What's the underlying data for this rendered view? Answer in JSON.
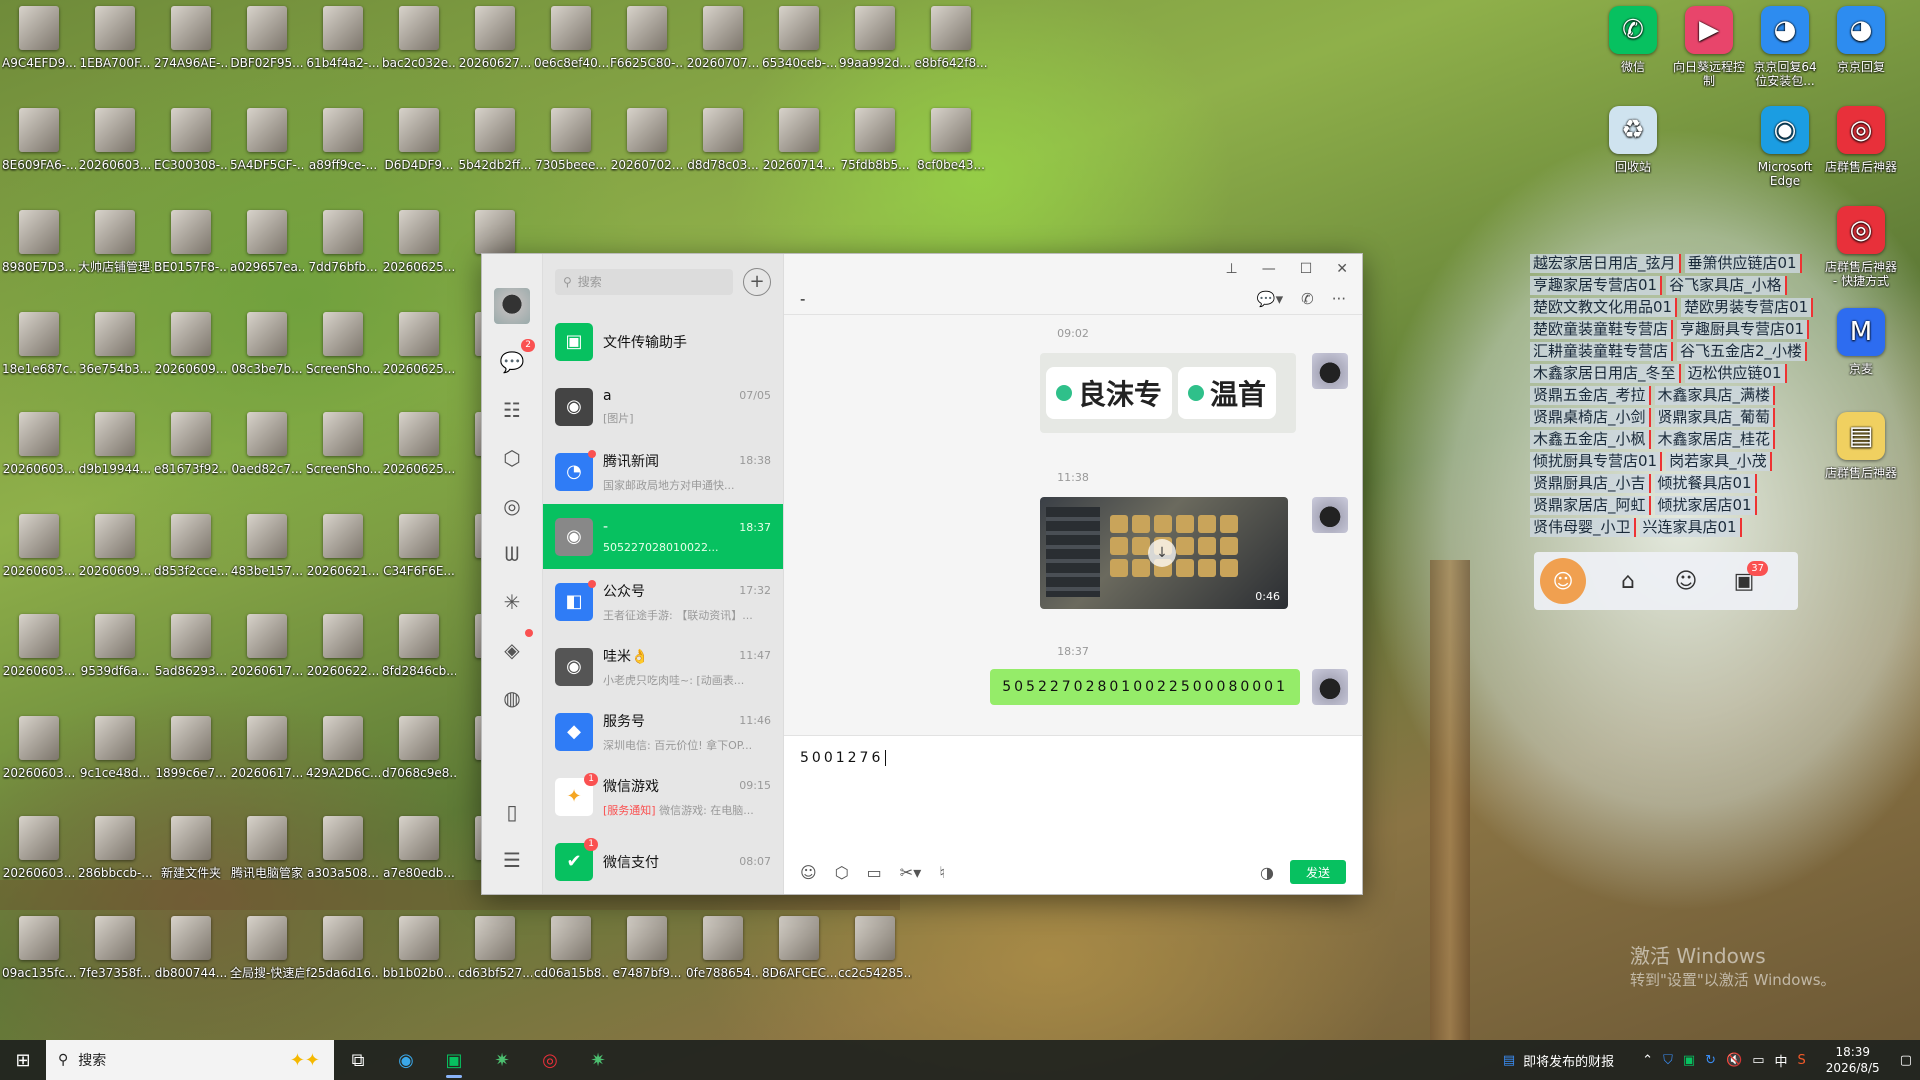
{
  "desktop": {
    "left_icons": [
      "A9C4EFD9...",
      "1EBA700F...",
      "274A96AE-...",
      "DBF02F95...",
      "61b4f4a2-...",
      "bac2c032e...",
      "20260627...",
      "0e6c8ef40...",
      "F6625C80-...",
      "20260707...",
      "65340ceb-...",
      "99aa992d...",
      "e8bf642f8...",
      "8E609FA6-...",
      "20260603...",
      "EC300308-...",
      "5A4DF5CF-...",
      "a89ff9ce-...",
      "D6D4DF9...",
      "5b42db2ff...",
      "7305beee...",
      "20260702...",
      "d8d78c03...",
      "20260714...",
      "75fdb8b5...",
      "8cf0be43...",
      "8980E7D3...",
      "大帅店铺管理系统",
      "BE0157F8-...",
      "a029657ea...",
      "7dd76bfb...",
      "20260625...",
      "e30",
      "18e1e687c...",
      "36e754b3...",
      "20260609...",
      "08c3be7b...",
      "ScreenSho...",
      "20260625...",
      "4e8",
      "20260603...",
      "d9b19944...",
      "e81673f92...",
      "0aed82c7...",
      "ScreenSho...",
      "20260625...",
      "ce3",
      "20260603...",
      "20260609...",
      "d853f2cce...",
      "483be157...",
      "20260621...",
      "C34F6F6E...",
      "bd7",
      "20260603...",
      "9539df6a...",
      "5ad86293...",
      "20260617...",
      "20260622...",
      "8fd2846cb...",
      "e79",
      "20260603...",
      "9c1ce48d...",
      "1899c6e7...",
      "20260617...",
      "429A2D6C...",
      "d7068c9e8...",
      "85f",
      "20260603...",
      "286bbccb-...",
      "新建文件夹",
      "腾讯电脑管家",
      "a303a508...",
      "a7e80edb...",
      "e3f",
      "09ac135fc...",
      "7fe37358f...",
      "db800744...",
      "全局搜-快速启动器",
      "f25da6d16...",
      "bb1b02b0...",
      "cd63bf527...",
      "cd06a15b8...",
      "e7487bf9...",
      "0fe788654...",
      "8D6AFCEC...",
      "cc2c54285..."
    ],
    "right_icons": [
      {
        "label": "微信",
        "color": "#07c160",
        "glyph": "wechat-icon"
      },
      {
        "label": "向日葵远程控制",
        "color": "#e8456b",
        "glyph": "sunflower-icon"
      },
      {
        "label": "京京回复64位安装包...",
        "color": "#2d8cf0",
        "glyph": "robot-icon"
      },
      {
        "label": "京京回复",
        "color": "#2d8cf0",
        "glyph": "robot-icon"
      },
      {
        "label": "回收站",
        "color": "#cfe3ef",
        "glyph": "recycle-bin-icon"
      },
      {
        "label": "Microsoft Edge",
        "color": "#1b9de2",
        "glyph": "edge-icon"
      },
      {
        "label": "店群售后神器",
        "color": "#e8303a",
        "glyph": "alarm-icon"
      },
      {
        "label": "店群售后神器 - 快捷方式",
        "color": "#e8303a",
        "glyph": "alarm-icon"
      },
      {
        "label": "京麦",
        "color": "#2d6cf0",
        "glyph": "jingmai-icon"
      },
      {
        "label": "店群售后神器",
        "color": "#f0d060",
        "glyph": "folder-icon"
      }
    ],
    "shop_rows": [
      [
        "越宏家居日用店_弦月",
        "垂箫供应链店01"
      ],
      [
        "亨趣家居专营店01",
        "谷飞家具店_小格"
      ],
      [
        "楚欧文教文化用品01",
        "楚欧男装专营店01"
      ],
      [
        "楚欧童装童鞋专营店",
        "亨趣厨具专营店01"
      ],
      [
        "汇耕童装童鞋专营店",
        "谷飞五金店2_小楼"
      ],
      [
        "木鑫家居日用店_冬至",
        "迈松供应链01"
      ],
      [
        "贤鼎五金店_考拉",
        "木鑫家具店_满楼"
      ],
      [
        "贤鼎桌椅店_小剑",
        "贤鼎家具店_葡萄"
      ],
      [
        "木鑫五金店_小枫",
        "木鑫家居店_桂花"
      ],
      [
        "倾扰厨具专营店01",
        "岗若家具_小茂"
      ],
      [
        "贤鼎厨具店_小吉",
        "倾扰餐具店01"
      ],
      [
        "贤鼎家居店_阿虹",
        "倾扰家居店01"
      ],
      [
        "贤伟母婴_小卫",
        "兴连家具店01"
      ]
    ],
    "shop_badge": "37",
    "watermark_line1": "激活 Windows",
    "watermark_line2": "转到\"设置\"以激活 Windows。"
  },
  "wechat": {
    "nav_badge": "2",
    "search_placeholder": "搜索",
    "chats": [
      {
        "name": "文件传输助手",
        "time": "",
        "preview": "",
        "color": "#07c160",
        "icon": "folder-transfer-icon"
      },
      {
        "name": "a",
        "time": "07/05",
        "preview": "[图片]",
        "color": "#444",
        "icon": "avatar"
      },
      {
        "name": "腾讯新闻",
        "time": "18:38",
        "preview": "国家邮政局地方对申通快...",
        "color": "#2f7cf6",
        "icon": "news-icon"
      },
      {
        "name": "-",
        "time": "18:37",
        "preview": "505227028010022...",
        "color": "#888",
        "icon": "avatar",
        "active": true
      },
      {
        "name": "公众号",
        "time": "17:32",
        "preview": "王者征途手游: 【联动资讯】...",
        "color": "#2f7cf6",
        "icon": "official-icon"
      },
      {
        "name": "哇米👌",
        "time": "11:47",
        "preview": "小老虎只吃肉哇~: [动画表...",
        "color": "#555",
        "icon": "avatar"
      },
      {
        "name": "服务号",
        "time": "11:46",
        "preview": "深圳电信: 百元价位! 拿下OP...",
        "color": "#2f7cf6",
        "icon": "service-icon"
      },
      {
        "name": "微信游戏",
        "time": "09:15",
        "preview_notice": "[服务通知]",
        "preview": " 微信游戏: 在电脑...",
        "color": "#fff",
        "icon": "game-icon"
      },
      {
        "name": "微信支付",
        "time": "08:07",
        "preview": "",
        "color": "#07c160",
        "icon": "pay-icon"
      }
    ],
    "chat_title": "-",
    "messages": {
      "ts1": "09:02",
      "tag1": "良沫专",
      "tag2": "温首",
      "ts2": "11:38",
      "video_duration": "0:46",
      "ts3": "18:37",
      "text": "505227028010022500080001"
    },
    "input_value": "5001276",
    "send_label": "发送"
  },
  "taskbar": {
    "search_placeholder": "搜索",
    "news": "即将发布的财报",
    "ime": "中",
    "time": "18:39",
    "date": "2026/8/5"
  }
}
